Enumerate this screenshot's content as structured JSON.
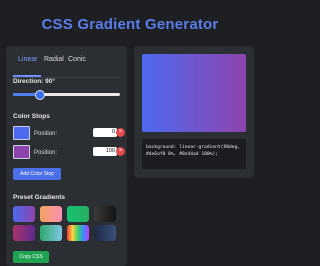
{
  "app": {
    "title": "CSS Gradient Generator"
  },
  "tabs": [
    {
      "label": "Linear",
      "active": true
    },
    {
      "label": "Radial",
      "active": false
    },
    {
      "label": "Conic",
      "active": false
    }
  ],
  "direction": {
    "label": "Direction: 90°",
    "value_deg": 90,
    "min_deg": 0,
    "max_deg": 360
  },
  "color_stops": {
    "label": "Color Stops",
    "stops": [
      {
        "color": "#4e6af0",
        "position_label": "Position:",
        "position": "0",
        "remove_label": "×"
      },
      {
        "color": "#8e44ad",
        "position_label": "Position:",
        "position": "100",
        "remove_label": "×"
      }
    ],
    "add_label": "Add Color Stop"
  },
  "presets": {
    "label": "Preset Gradients",
    "items": [
      {
        "gradient": "linear-gradient(90deg, #4e6af0, #8e44ad)"
      },
      {
        "gradient": "linear-gradient(90deg, #f4a261, #f78fb3)"
      },
      {
        "gradient": "linear-gradient(90deg, #16c172, #27ae60)"
      },
      {
        "gradient": "linear-gradient(90deg, #3a3a3a, #141414)"
      },
      {
        "gradient": "linear-gradient(90deg, #a8326b, #5d2a8f)"
      },
      {
        "gradient": "linear-gradient(90deg, #2ea86b, #7ec8e3)"
      },
      {
        "gradient": "linear-gradient(90deg, #ff3b3b, #ffd23f, #3bd26b, #3b8bff, #c13bff)"
      },
      {
        "gradient": "linear-gradient(90deg, #1f2a44, #3a4f7a)"
      }
    ]
  },
  "copy_label": "Copy CSS",
  "preview": {
    "gradient": "linear-gradient(90deg, #4e6af0 0%, #8e44ad 100%)"
  },
  "code": {
    "text": "background: linear-gradient(90deg,#4e6af0 0%, #8e44ad 100%);"
  },
  "colors": {
    "accent": "#4b6fe8",
    "title": "#5b7de9",
    "danger": "#e04a4a",
    "success": "#1fa352"
  }
}
